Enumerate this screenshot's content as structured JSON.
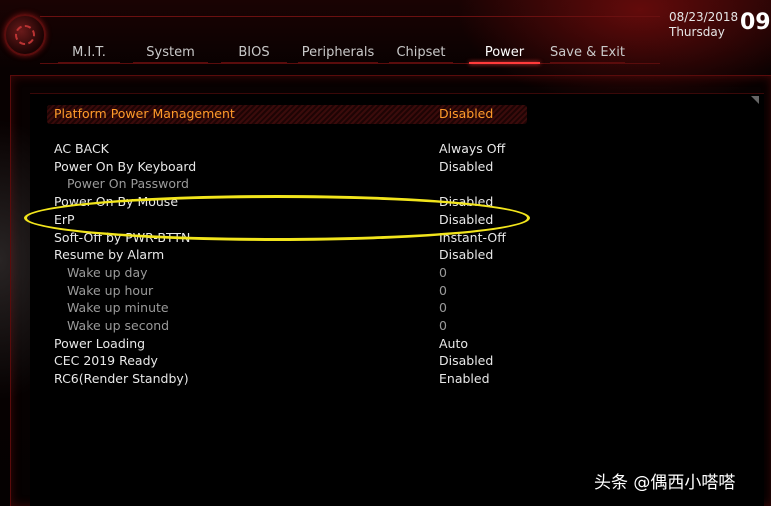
{
  "header": {
    "tabs": [
      {
        "label": "M.I.T."
      },
      {
        "label": "System"
      },
      {
        "label": "BIOS"
      },
      {
        "label": "Peripherals"
      },
      {
        "label": "Chipset"
      },
      {
        "label": "Power",
        "active": true
      },
      {
        "label": "Save & Exit"
      }
    ],
    "date": "08/23/2018",
    "day": "Thursday",
    "time": "09"
  },
  "settings": {
    "header": {
      "label": "Platform Power Management",
      "value": "Disabled"
    },
    "items": [
      {
        "label": "AC BACK",
        "value": "Always Off"
      },
      {
        "label": "Power On By Keyboard",
        "value": "Disabled"
      },
      {
        "label": "Power On Password",
        "value": "",
        "sub": true
      },
      {
        "label": "Power On By Mouse",
        "value": "Disabled"
      },
      {
        "label": "ErP",
        "value": "Disabled"
      },
      {
        "label": "Soft-Off by PWR-BTTN",
        "value": "Instant-Off"
      },
      {
        "label": "Resume by Alarm",
        "value": "Disabled"
      },
      {
        "label": "Wake up day",
        "value": "0",
        "sub": true
      },
      {
        "label": "Wake up hour",
        "value": "0",
        "sub": true
      },
      {
        "label": "Wake up minute",
        "value": "0",
        "sub": true
      },
      {
        "label": "Wake up second",
        "value": "0",
        "sub": true
      },
      {
        "label": "Power Loading",
        "value": "Auto"
      },
      {
        "label": "CEC 2019 Ready",
        "value": "Disabled"
      },
      {
        "label": "RC6(Render Standby)",
        "value": "Enabled"
      }
    ]
  },
  "annotation": {
    "color": "#f2e51c"
  },
  "watermark": "头条 @偶西小嗒嗒",
  "colors": {
    "accent": "#ff3b3b",
    "highlight_text": "#ff9b2a",
    "background": "#000000"
  }
}
